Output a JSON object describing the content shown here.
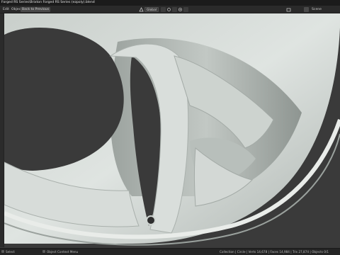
{
  "window": {
    "title": "Forged RS Series\\Brixton Forged RS Series (ezpoly).blend"
  },
  "header": {
    "menu_edit": "Edit",
    "menu_object": "Object",
    "button_back": "Back to Previous",
    "orientation": "Global",
    "scene_label": "Scene"
  },
  "status": {
    "select_label": "Select",
    "menu_label": "Object Context Menu",
    "stats": "Collection | Circle | Verts 14,678 | Faces 14,984 | Tris 27,874 | Objects 0/1"
  }
}
